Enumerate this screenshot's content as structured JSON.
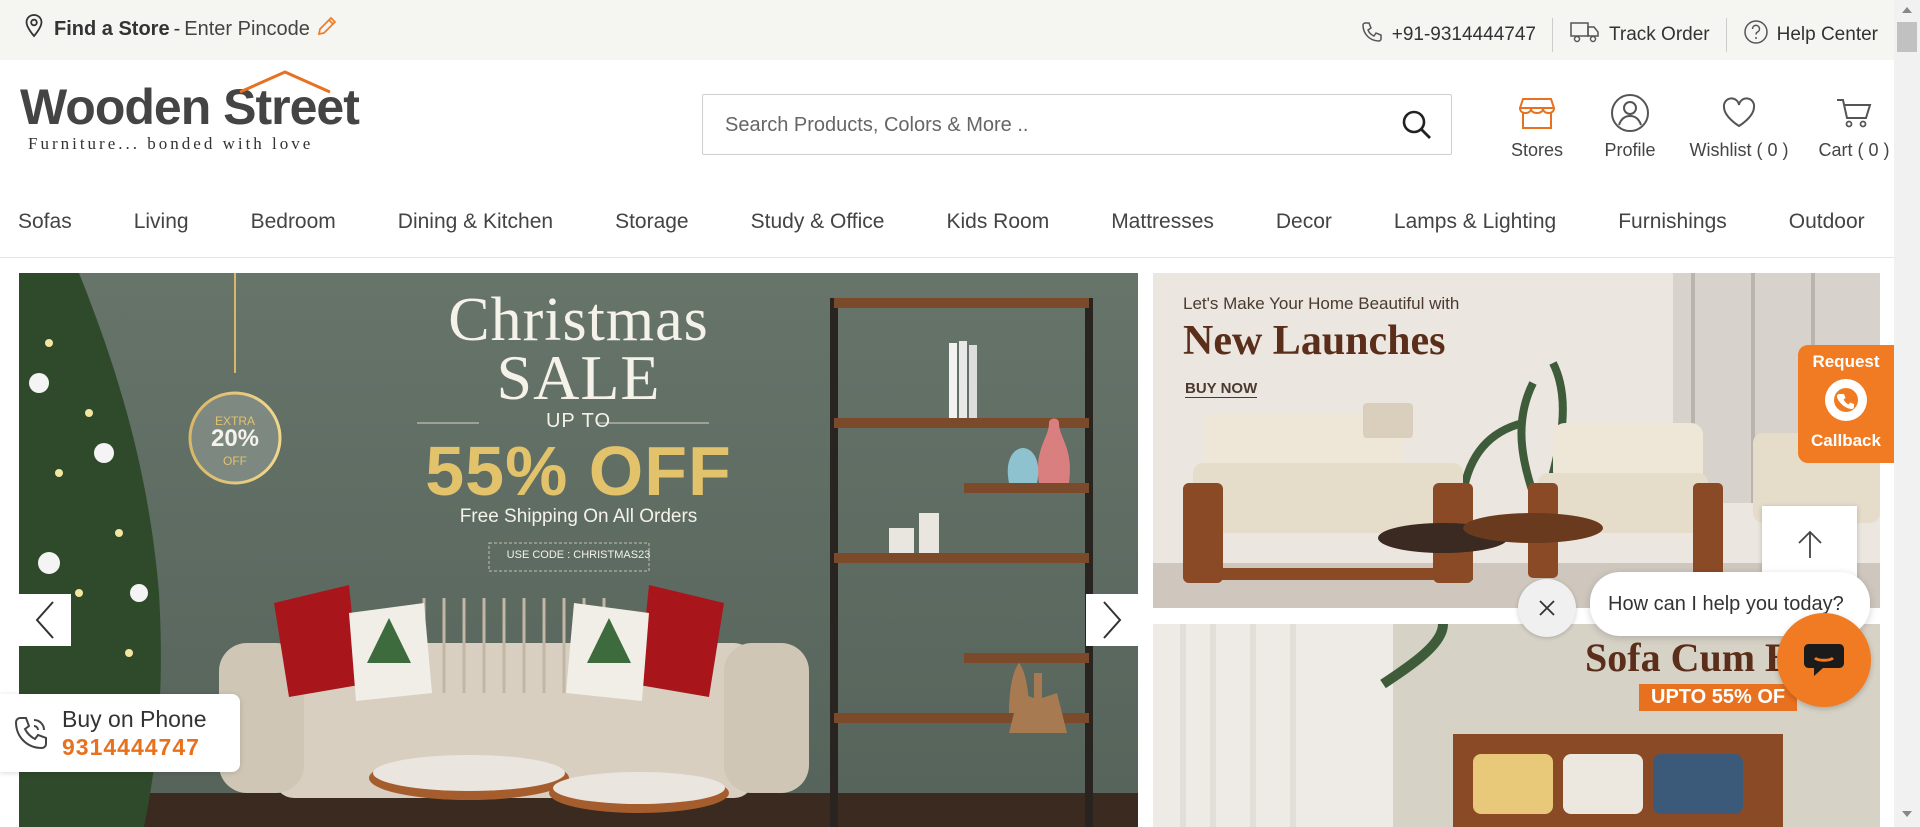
{
  "topbar": {
    "find_store": "Find a Store",
    "separator": "-",
    "enter_pincode": "Enter Pincode",
    "phone": "+91-9314444747",
    "track_order": "Track Order",
    "help_center": "Help Center"
  },
  "header": {
    "logo_name": "Wooden Street",
    "logo_tagline": "Furniture... bonded with love",
    "search_placeholder": "Search Products, Colors & More ..",
    "icons": {
      "stores": "Stores",
      "profile": "Profile",
      "wishlist": "Wishlist ( 0 )",
      "cart": "Cart ( 0 )"
    }
  },
  "nav": {
    "items": [
      "Sofas",
      "Living",
      "Bedroom",
      "Dining & Kitchen",
      "Storage",
      "Study & Office",
      "Kids Room",
      "Mattresses",
      "Decor",
      "Lamps & Lighting",
      "Furnishings",
      "Outdoor"
    ]
  },
  "main_banner": {
    "title_line1": "Christmas",
    "title_line2": "SALE",
    "up_to": "UP TO",
    "discount": "55% OFF",
    "shipping": "Free Shipping On All Orders",
    "code": "USE CODE : CHRISTMAS23",
    "badge_extra": "EXTRA",
    "badge_pct": "20%",
    "badge_off": "OFF"
  },
  "side_banner_1": {
    "kicker": "Let's Make Your Home Beautiful with",
    "title": "New Launches",
    "cta": "BUY NOW"
  },
  "side_banner_2": {
    "title": "Sofa Cum B",
    "offer": "UPTO 55% OF"
  },
  "buy_on_phone": {
    "label": "Buy on Phone",
    "number": "9314444747"
  },
  "callback": {
    "line1": "Request",
    "line2": "Callback"
  },
  "chat": {
    "prompt": "How can I help you today?"
  },
  "colors": {
    "accent": "#f07b22",
    "text": "#333333",
    "topbar_bg": "#f5f5f2"
  }
}
